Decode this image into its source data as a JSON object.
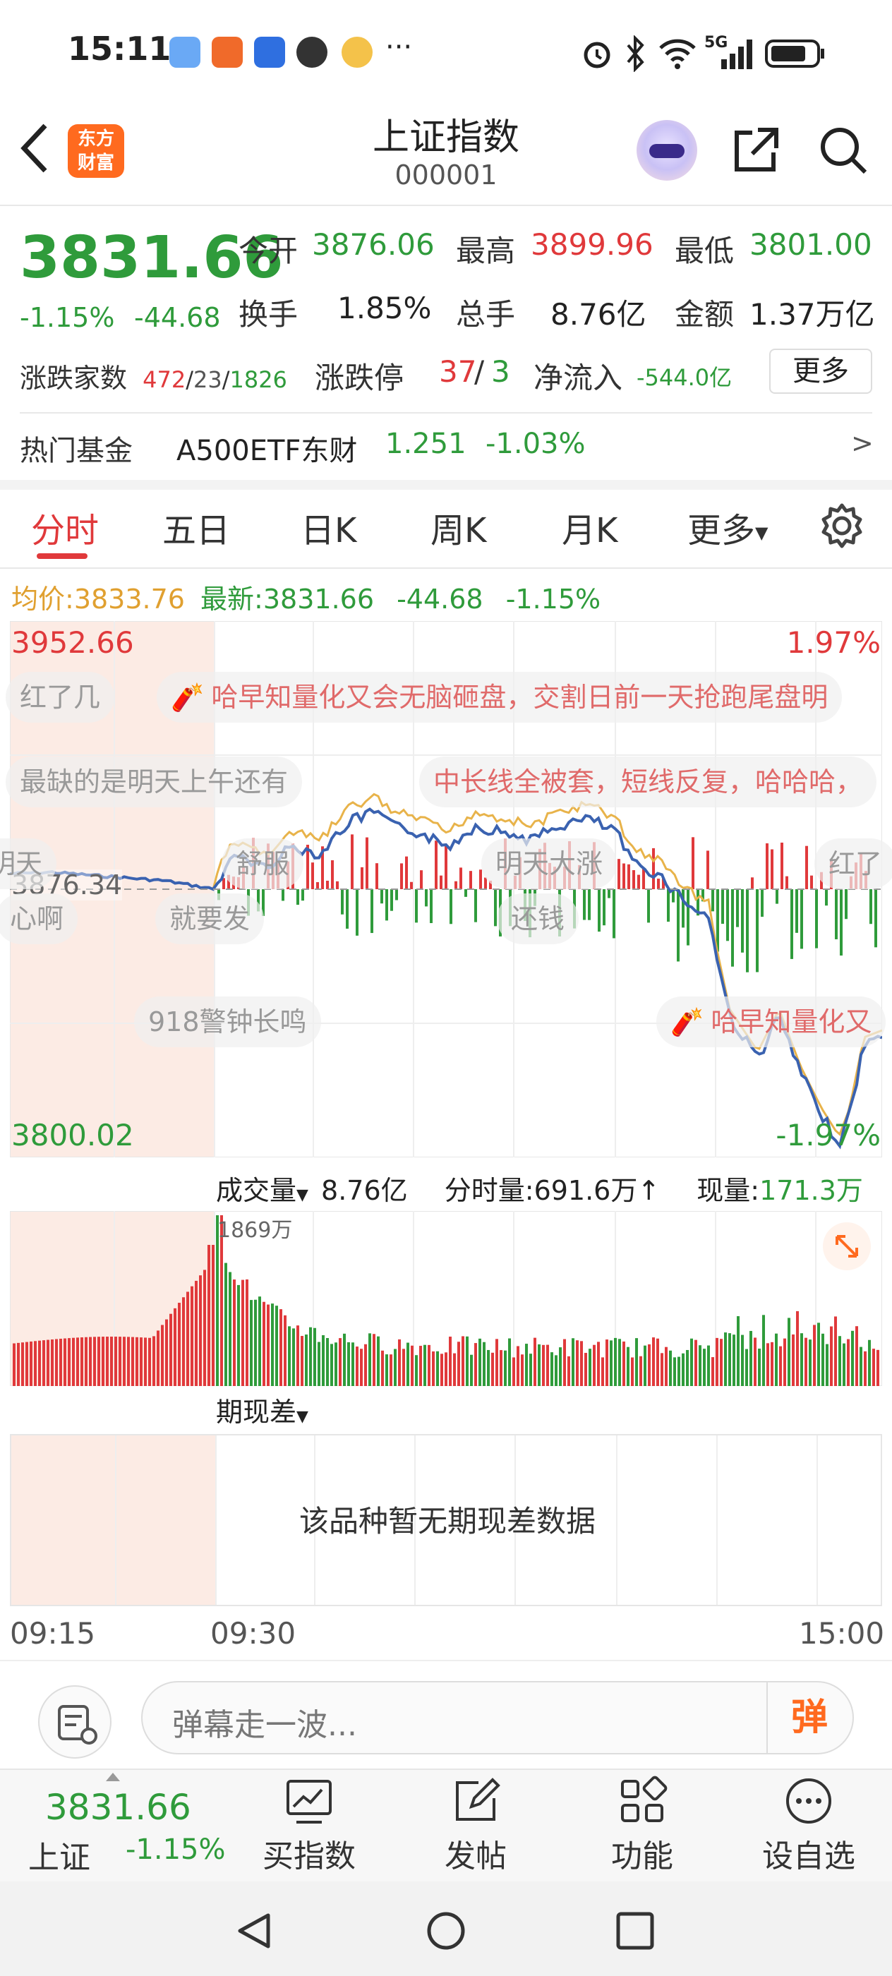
{
  "status_bar": {
    "time": "15:11",
    "more": "···",
    "network": "5G"
  },
  "header": {
    "logo_line1": "东方",
    "logo_line2": "财富",
    "title": "上证指数",
    "code": "000001"
  },
  "quote": {
    "price": "3831.66",
    "pct": "-1.15%",
    "change": "-44.68",
    "open_label": "今开",
    "open": "3876.06",
    "high_label": "最高",
    "high": "3899.96",
    "low_label": "最低",
    "low": "3801.00",
    "turnover_label": "换手",
    "turnover": "1.85%",
    "volume_label": "总手",
    "volume": "8.76亿",
    "amount_label": "金额",
    "amount": "1.37万亿",
    "breadth_label": "涨跌家数",
    "breadth_up": "472",
    "breadth_flat": "23",
    "breadth_down": "1826",
    "sep": "/",
    "limit_label": "涨跌停",
    "limit_up": "37",
    "limit_down": "3",
    "netflow_label": "净流入",
    "netflow": "-544.0亿",
    "more_button": "更多"
  },
  "hot_fund": {
    "label": "热门基金",
    "name": "A500ETF东财",
    "price": "1.251",
    "pct": "-1.03%",
    "arrow": ">"
  },
  "tabs": [
    "分时",
    "五日",
    "日K",
    "周K",
    "月K",
    "更多"
  ],
  "avg_line": {
    "avg_label": "均价:",
    "avg": "3833.76",
    "latest_label": "最新:",
    "latest": "3831.66",
    "chg": "-44.68",
    "pct": "-1.15%"
  },
  "intraday": {
    "y_top": "3952.66",
    "y_bottom": "3800.02",
    "pct_top": "1.97%",
    "pct_bottom": "-1.97%",
    "prev_close": "3876.34",
    "danmaku": [
      {
        "text": "红了几",
        "icon": false
      },
      {
        "text": "哈早知量化又会无脑砸盘，交割日前一天抢跑尾盘明",
        "icon": true
      },
      {
        "text": "最缺的是明天上午还有",
        "icon": false
      },
      {
        "text": "中长线全被套，短线反复，哈哈哈，",
        "icon": false
      },
      {
        "text": "明天",
        "icon": false
      },
      {
        "text": "舒服",
        "icon": false
      },
      {
        "text": "明天大涨",
        "icon": false
      },
      {
        "text": "红了",
        "icon": false
      },
      {
        "text": "心啊",
        "icon": false
      },
      {
        "text": "就要发",
        "icon": false
      },
      {
        "text": "还钱",
        "icon": false
      },
      {
        "text": "918警钟长鸣",
        "icon": false
      },
      {
        "text": "哈早知量化又",
        "icon": true
      }
    ]
  },
  "volume": {
    "label": "成交量",
    "total": "8.76亿",
    "minute_label": "分时量:",
    "minute": "691.6万",
    "now_label": "现量:",
    "now": "171.3万",
    "peak": "1869万"
  },
  "basis": {
    "label": "期现差",
    "empty_msg": "该品种暂无期现差数据"
  },
  "time_axis": [
    "09:15",
    "09:30",
    "15:00"
  ],
  "danmaku_input": {
    "placeholder": "弹幕走一波...",
    "send": "弹"
  },
  "bottom_nav": {
    "price": "3831.66",
    "name": "上证",
    "pct": "-1.15%",
    "items": [
      "买指数",
      "发帖",
      "功能",
      "设自选"
    ]
  },
  "colors": {
    "up": "#e0393b",
    "down": "#2f9b3b",
    "price_line": "#3a62b0",
    "avg_line": "#e8b34a",
    "brand": "#ff6a1f"
  }
}
